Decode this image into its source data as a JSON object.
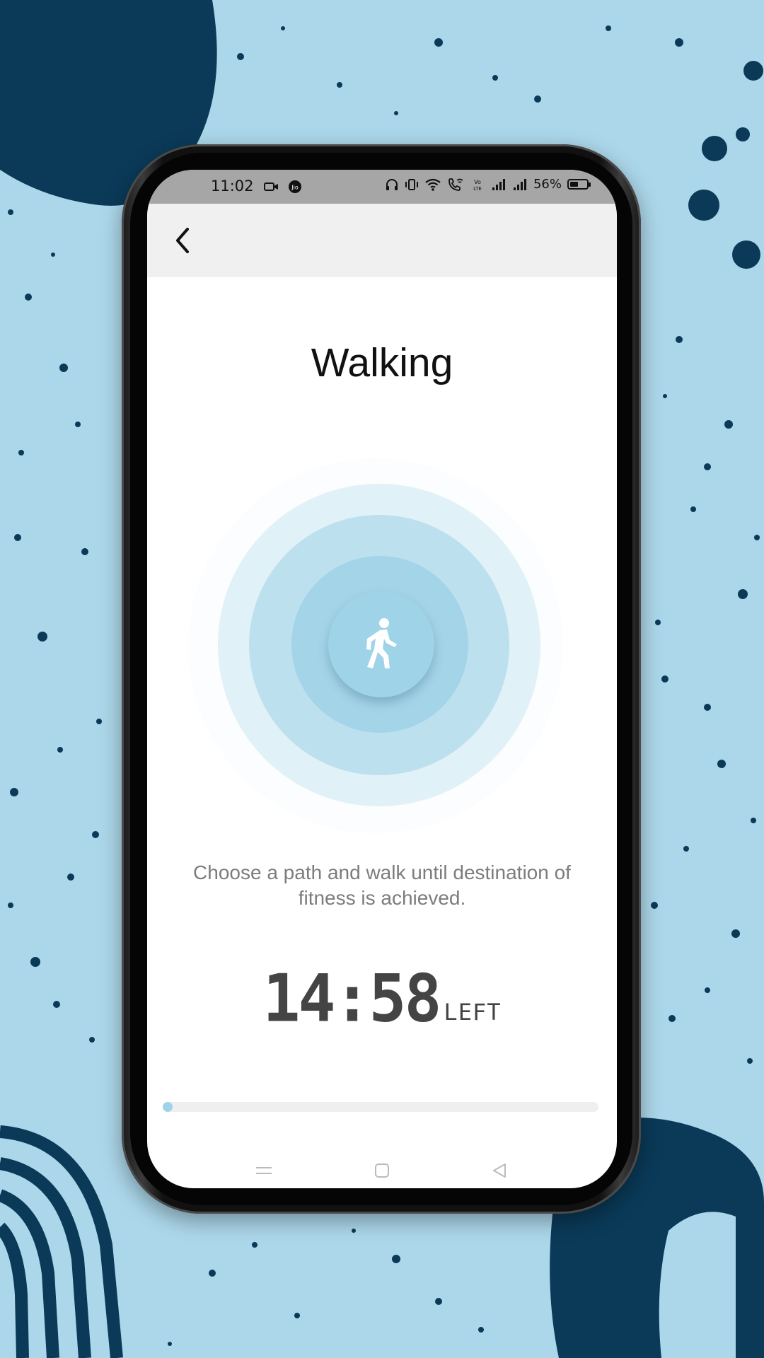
{
  "status_bar": {
    "time": "11:02",
    "battery_text": "56%",
    "battery_level": 0.56,
    "left_icons": [
      "video-icon",
      "jio-icon"
    ],
    "right_icons": [
      "headphones-icon",
      "vibrate-icon",
      "wifi-icon",
      "wifi-call-icon",
      "volte-icon",
      "signal-icon",
      "signal-icon",
      "battery-icon"
    ]
  },
  "app_bar": {
    "back_icon": "chevron-left-icon"
  },
  "page": {
    "title": "Walking",
    "activity_icon": "walking-person-icon",
    "description": "Choose a path and walk until destination of fitness is achieved.",
    "timer_value": "14:58",
    "timer_suffix": "LEFT",
    "progress": 0.01
  },
  "colors": {
    "background": "#acd7ea",
    "decoration": "#0a3a58",
    "accent": "#9fd3e7"
  },
  "nav_bar": {
    "icons": [
      "menu-icon",
      "home-square-icon",
      "back-triangle-icon"
    ]
  }
}
